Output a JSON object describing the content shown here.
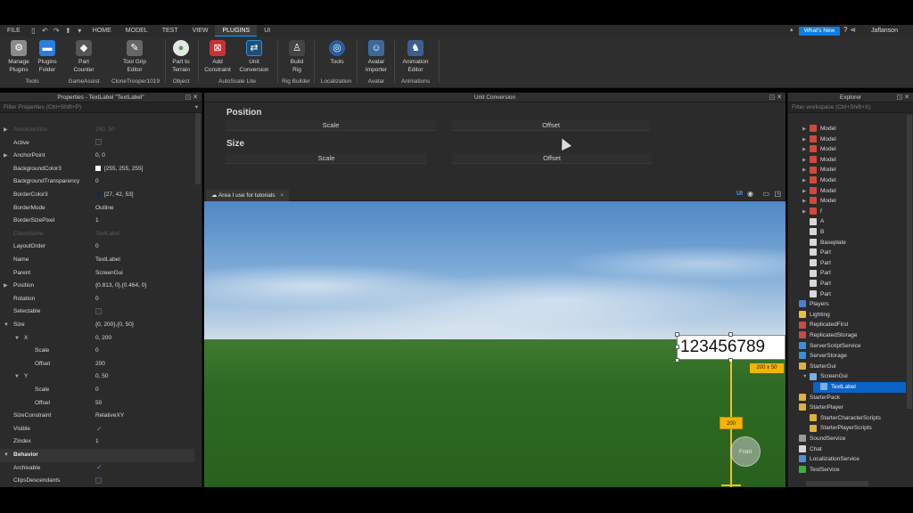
{
  "menubar": {
    "items": [
      "FILE",
      "HOME",
      "MODEL",
      "TEST",
      "VIEW",
      "PLUGINS",
      "UI"
    ],
    "active": "PLUGINS",
    "whats_new": "What's New",
    "username": "Jaflanson"
  },
  "ribbon": {
    "buttons": [
      {
        "label1": "Manage",
        "label2": "Plugins",
        "icon": "gear-icon",
        "color": "#8a8a8a"
      },
      {
        "label1": "Plugins",
        "label2": "Folder",
        "icon": "folder-icon",
        "color": "#2b7de0"
      },
      {
        "label1": "Part",
        "label2": "Counter",
        "icon": "part-icon",
        "color": "#9c9c9c"
      },
      {
        "label1": "Tool Grip",
        "label2": "Editor",
        "icon": "grip-icon",
        "color": "#9c9c9c"
      },
      {
        "label1": "Part to",
        "label2": "Terrain",
        "icon": "terrain-icon",
        "color": "#e6e6e6"
      },
      {
        "label1": "Add",
        "label2": "Constraint",
        "icon": "constraint-icon",
        "color": "#c83232"
      },
      {
        "label1": "Unit",
        "label2": "Conversion",
        "icon": "conversion-icon",
        "color": "#2a8fd6"
      },
      {
        "label1": "Build",
        "label2": "Rig",
        "icon": "rig-icon",
        "color": "#dcdcdc"
      },
      {
        "label1": "Tools",
        "label2": "",
        "icon": "globe-icon",
        "color": "#4a90e2"
      },
      {
        "label1": "Avatar",
        "label2": "Importer",
        "icon": "avatar-icon",
        "color": "#7aa7d8"
      },
      {
        "label1": "Animation",
        "label2": "Editor",
        "icon": "animation-icon",
        "color": "#6b8fc8"
      }
    ],
    "groups": [
      "Tools",
      "GameAssist",
      "CloneTrooper1019",
      "Object",
      "AutoScale Lite",
      "Rig Builder",
      "Localization",
      "Avatar",
      "Animations"
    ]
  },
  "properties": {
    "title": "Properties - TextLabel \"TextLabel\"",
    "filter_placeholder": "Filter Properties (Ctrl+Shift+P)",
    "rows": [
      {
        "name": "AbsoluteSize",
        "value": "200, 50",
        "dim": true,
        "arrow": "▶"
      },
      {
        "name": "Active",
        "value": "",
        "check": "off"
      },
      {
        "name": "AnchorPoint",
        "value": "0, 0",
        "arrow": "▶"
      },
      {
        "name": "BackgroundColor3",
        "value": "[255, 255, 255]",
        "swatch": "#ffffff"
      },
      {
        "name": "BackgroundTransparency",
        "value": "0"
      },
      {
        "name": "BorderColor3",
        "value": "[27, 42, 53]",
        "swatch": "#1b2a35"
      },
      {
        "name": "BorderMode",
        "value": "Outline"
      },
      {
        "name": "BorderSizePixel",
        "value": "1"
      },
      {
        "name": "ClassName",
        "value": "TextLabel",
        "dim": true
      },
      {
        "name": "LayoutOrder",
        "value": "0"
      },
      {
        "name": "Name",
        "value": "TextLabel"
      },
      {
        "name": "Parent",
        "value": "ScreenGui"
      },
      {
        "name": "Position",
        "value": "{0.813, 0},{0.464, 0}",
        "arrow": "▶"
      },
      {
        "name": "Rotation",
        "value": "0"
      },
      {
        "name": "Selectable",
        "value": "",
        "check": "off"
      },
      {
        "name": "Size",
        "value": "{0, 200},{0, 50}",
        "arrow": "▼"
      },
      {
        "name": "X",
        "value": "0, 200",
        "arrow": "▼",
        "indent": 1
      },
      {
        "name": "Scale",
        "value": "0",
        "indent": 2
      },
      {
        "name": "Offset",
        "value": "200",
        "indent": 2
      },
      {
        "name": "Y",
        "value": "0, 50",
        "arrow": "▼",
        "indent": 1
      },
      {
        "name": "Scale",
        "value": "0",
        "indent": 2
      },
      {
        "name": "Offset",
        "value": "50",
        "indent": 2
      },
      {
        "name": "SizeConstraint",
        "value": "RelativeXY"
      },
      {
        "name": "Visible",
        "value": "",
        "check": "on"
      },
      {
        "name": "ZIndex",
        "value": "1"
      },
      {
        "name": "Behavior",
        "value": "",
        "section": true,
        "arrow": "▼"
      },
      {
        "name": "Archivable",
        "value": "",
        "check": "on"
      },
      {
        "name": "ClipsDescendants",
        "value": "",
        "check": "off"
      }
    ]
  },
  "unit_conversion": {
    "title": "Unit Conversion",
    "position_label": "Position",
    "size_label": "Size",
    "scale_label": "Scale",
    "offset_label": "Offset"
  },
  "viewport": {
    "tab_label": "Area I use for tutorials",
    "tab_close": "×",
    "ui_toggle": "UI",
    "textlabel_text": "123456789",
    "size_badge": "200 x 50",
    "distance_badge": "200",
    "view_cube_label": "Front"
  },
  "explorer": {
    "title": "Explorer",
    "filter_placeholder": "Filter workspace (Ctrl+Shift+X)",
    "items": [
      {
        "label": "Model",
        "indent": 1,
        "twisty": "▶",
        "icon": "model-icon",
        "color": "#d04a3a"
      },
      {
        "label": "Model",
        "indent": 1,
        "twisty": "▶",
        "icon": "model-icon",
        "color": "#d04a3a"
      },
      {
        "label": "Model",
        "indent": 1,
        "twisty": "▶",
        "icon": "model-icon",
        "color": "#d04a3a"
      },
      {
        "label": "Model",
        "indent": 1,
        "twisty": "▶",
        "icon": "model-icon",
        "color": "#d04a3a"
      },
      {
        "label": "Model",
        "indent": 1,
        "twisty": "▶",
        "icon": "model-icon",
        "color": "#d04a3a"
      },
      {
        "label": "Model",
        "indent": 1,
        "twisty": "▶",
        "icon": "model-icon",
        "color": "#d04a3a"
      },
      {
        "label": "Model",
        "indent": 1,
        "twisty": "▶",
        "icon": "model-icon",
        "color": "#d04a3a"
      },
      {
        "label": "Model",
        "indent": 1,
        "twisty": "▶",
        "icon": "model-icon",
        "color": "#d04a3a"
      },
      {
        "label": "f",
        "indent": 1,
        "twisty": "▶",
        "icon": "model-icon",
        "color": "#d04a3a"
      },
      {
        "label": "A",
        "indent": 1,
        "twisty": "",
        "icon": "part-icon",
        "color": "#d8d8d8"
      },
      {
        "label": "B",
        "indent": 1,
        "twisty": "",
        "icon": "part-icon",
        "color": "#d8d8d8"
      },
      {
        "label": "Baseplate",
        "indent": 1,
        "twisty": "",
        "icon": "part-icon",
        "color": "#d8d8d8"
      },
      {
        "label": "Part",
        "indent": 1,
        "twisty": "",
        "icon": "part-icon",
        "color": "#d8d8d8"
      },
      {
        "label": "Part",
        "indent": 1,
        "twisty": "",
        "icon": "part-icon",
        "color": "#d8d8d8"
      },
      {
        "label": "Part",
        "indent": 1,
        "twisty": "",
        "icon": "part-icon",
        "color": "#d8d8d8"
      },
      {
        "label": "Part",
        "indent": 1,
        "twisty": "",
        "icon": "part-icon",
        "color": "#d8d8d8"
      },
      {
        "label": "Part",
        "indent": 1,
        "twisty": "",
        "icon": "part-icon",
        "color": "#d8d8d8"
      },
      {
        "label": "Players",
        "indent": 0,
        "twisty": "",
        "icon": "players-icon",
        "color": "#4a7fd0"
      },
      {
        "label": "Lighting",
        "indent": 0,
        "twisty": "",
        "icon": "lighting-icon",
        "color": "#e8c23a"
      },
      {
        "label": "ReplicatedFirst",
        "indent": 0,
        "twisty": "",
        "icon": "replicated-icon",
        "color": "#c84a4a"
      },
      {
        "label": "ReplicatedStorage",
        "indent": 0,
        "twisty": "",
        "icon": "replicated-icon",
        "color": "#c84a4a"
      },
      {
        "label": "ServerScriptService",
        "indent": 0,
        "twisty": "",
        "icon": "script-service-icon",
        "color": "#3a8fd6"
      },
      {
        "label": "ServerStorage",
        "indent": 0,
        "twisty": "",
        "icon": "storage-icon",
        "color": "#3a8fd6"
      },
      {
        "label": "StarterGui",
        "indent": 0,
        "twisty": "",
        "icon": "startergui-icon",
        "color": "#e0b040"
      },
      {
        "label": "ScreenGui",
        "indent": 1,
        "twisty": "▼",
        "icon": "screengui-icon",
        "color": "#7ab0e0"
      },
      {
        "label": "TextLabel",
        "indent": 2,
        "twisty": "",
        "icon": "textlabel-icon",
        "color": "#7ab0e0",
        "selected": true
      },
      {
        "label": "StarterPack",
        "indent": 0,
        "twisty": "",
        "icon": "starterpack-icon",
        "color": "#e0b040"
      },
      {
        "label": "StarterPlayer",
        "indent": 0,
        "twisty": "",
        "icon": "starterplayer-icon",
        "color": "#e0b040"
      },
      {
        "label": "StarterCharacterScripts",
        "indent": 1,
        "twisty": "",
        "icon": "folder-icon",
        "color": "#e0b040"
      },
      {
        "label": "StarterPlayerScripts",
        "indent": 1,
        "twisty": "",
        "icon": "folder-icon",
        "color": "#e0b040"
      },
      {
        "label": "SoundService",
        "indent": 0,
        "twisty": "",
        "icon": "sound-icon",
        "color": "#9a9a9a"
      },
      {
        "label": "Chat",
        "indent": 0,
        "twisty": "",
        "icon": "chat-icon",
        "color": "#d8d8d8"
      },
      {
        "label": "LocalizationService",
        "indent": 0,
        "twisty": "",
        "icon": "localization-icon",
        "color": "#4a90e2"
      },
      {
        "label": "TestService",
        "indent": 0,
        "twisty": "",
        "icon": "test-icon",
        "color": "#3ab03a"
      }
    ]
  }
}
